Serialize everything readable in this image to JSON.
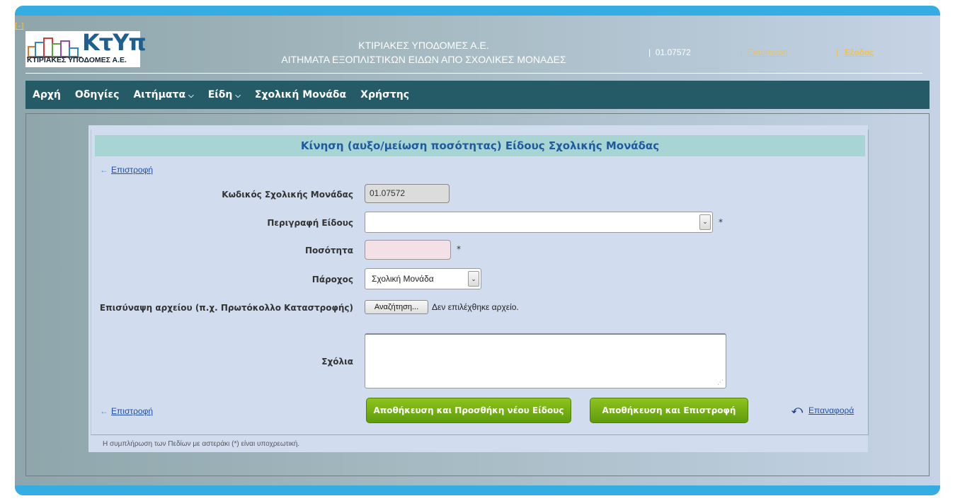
{
  "header": {
    "collapse_label": "[-]",
    "logo_text": "ΚτΥπ",
    "logo_subtext": "ΚΤΙΡΙΑΚΕΣ ΥΠΟΔΟΜΕΣ Α.Ε.",
    "title_line1": "ΚΤΙΡΙΑΚΕΣ ΥΠΟΔΟΜΕΣ Α.Ε.",
    "title_line2": "ΑΙΤΗΜΑΤΑ ΕΞΟΠΛΙΣΤΙΚΩΝ ΕΙΔΩΝ ΑΠΟ ΣΧΟΛΙΚΕΣ ΜΟΝΑΔΕΣ",
    "separator": "|",
    "school_code": "01.07572",
    "print_label": "Εκτύπωση",
    "exit_label": "Έξοδος"
  },
  "nav": {
    "items": [
      {
        "label": "Αρχή",
        "dropdown": false
      },
      {
        "label": "Οδηγίες",
        "dropdown": false
      },
      {
        "label": "Αιτήματα",
        "dropdown": true
      },
      {
        "label": "Είδη",
        "dropdown": true
      },
      {
        "label": "Σχολική Μονάδα",
        "dropdown": false
      },
      {
        "label": "Χρήστης",
        "dropdown": false
      }
    ]
  },
  "form": {
    "title": "Κίνηση (αυξο/μείωση ποσότητας) Είδους Σχολικής Μονάδας",
    "back_label": "Επιστροφή",
    "school_code_label": "Κωδικός Σχολικής Μονάδας",
    "school_code_value": "01.07572",
    "item_desc_label": "Περιγραφή Είδους",
    "item_desc_value": "",
    "quantity_label": "Ποσότητα",
    "quantity_value": "",
    "provider_label": "Πάροχος",
    "provider_value": "Σχολική Μονάδα",
    "attachment_label": "Επισύναψη αρχείου (π.χ. Πρωτόκολλο Καταστροφής)",
    "browse_label": "Αναζήτηση...",
    "no_file_label": "Δεν επιλέχθηκε αρχείο.",
    "comments_label": "Σχόλια",
    "comments_value": "",
    "required_mark": "*",
    "save_add_label": "Αποθήκευση και Προσθήκη νέου Είδους",
    "save_return_label": "Αποθήκευση και Επιστροφή",
    "reset_label": "Επαναφορά",
    "footnote": "Η συμπλήρωση των Πεδίων με αστεράκι (*) είναι υποχρεωτική."
  },
  "colors": {
    "nav_bg": "#245b67",
    "accent_bar": "#35ade2",
    "title_bar": "#a8d4d4",
    "button_green": "#6fae12",
    "link": "#1f4fa8",
    "header_link": "#f0c24b"
  },
  "icons": {
    "back": "arrow-left-icon",
    "reset": "undo-arrow-icon",
    "dropdown": "chevron-down-icon"
  }
}
